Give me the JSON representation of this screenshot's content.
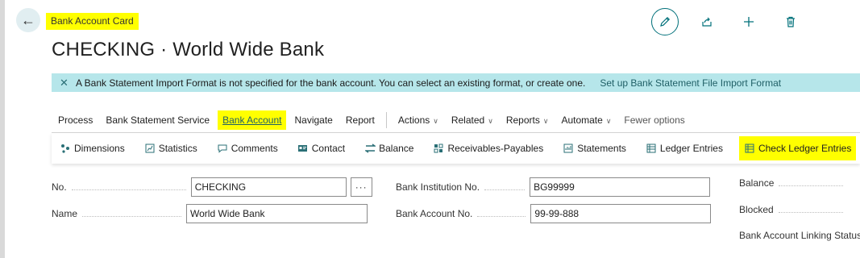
{
  "header": {
    "back_label": "←",
    "page_kind": "Bank Account Card",
    "title": "CHECKING · World Wide Bank"
  },
  "top_actions": [
    {
      "name": "edit-icon",
      "glyph": "✎"
    },
    {
      "name": "share-icon",
      "glyph": "⇪"
    },
    {
      "name": "plus-icon",
      "glyph": "+"
    },
    {
      "name": "trash-icon",
      "glyph": "🗑"
    }
  ],
  "notification": {
    "close_glyph": "✕",
    "message": "A Bank Statement Import Format is not specified for the bank account. You can select an existing format, or create one.",
    "action_link": "Set up Bank Statement File Import Format"
  },
  "menu": {
    "process": "Process",
    "bank_statement_service": "Bank Statement Service",
    "bank_account": "Bank Account",
    "navigate": "Navigate",
    "report": "Report",
    "actions": "Actions",
    "related": "Related",
    "reports": "Reports",
    "automate": "Automate",
    "fewer_options": "Fewer options"
  },
  "toolbar": {
    "dimensions": "Dimensions",
    "statistics": "Statistics",
    "comments": "Comments",
    "contact": "Contact",
    "balance": "Balance",
    "receivables_payables": "Receivables-Payables",
    "statements": "Statements",
    "ledger_entries": "Ledger Entries",
    "check_ledger_entries": "Check Ledger Entries"
  },
  "fields": {
    "no_label": "No.",
    "no_value": "CHECKING",
    "assist_glyph": "···",
    "name_label": "Name",
    "name_value": "World Wide Bank",
    "bank_institution_label": "Bank Institution No.",
    "bank_institution_value": "BG99999",
    "bank_account_no_label": "Bank Account No.",
    "bank_account_no_value": "99-99-888",
    "balance_label": "Balance",
    "blocked_label": "Blocked",
    "linking_status_label": "Bank Account Linking Status"
  },
  "colors": {
    "highlight": "#ffff00",
    "notification_bg": "#b6e6ea",
    "accent": "#00707a"
  }
}
